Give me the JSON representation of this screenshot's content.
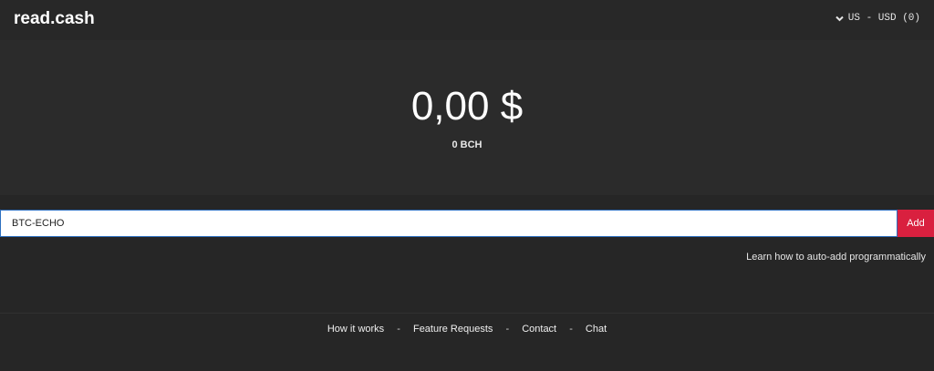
{
  "header": {
    "brand": "read.cash",
    "currency_label": "US - USD (0)"
  },
  "balance": {
    "amount": "0,00 $",
    "bch": "0 BCH"
  },
  "add_form": {
    "input_value": "BTC-ECHO",
    "add_label": "Add",
    "learn_link": "Learn how to auto-add programmatically"
  },
  "footer": {
    "links": [
      "How it works",
      "Feature Requests",
      "Contact",
      "Chat"
    ],
    "separator": "-"
  },
  "colors": {
    "accent": "#d9203f",
    "input_border": "#2d6fbf",
    "background": "#262626"
  }
}
